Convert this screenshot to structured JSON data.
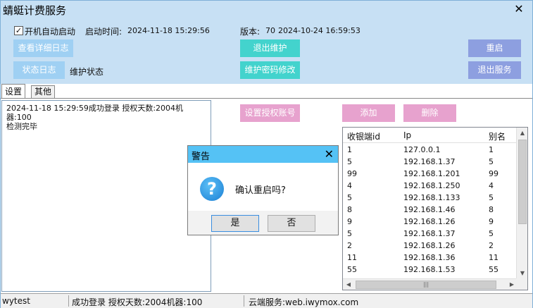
{
  "window": {
    "title": "蜻蜓计费服务",
    "close": "✕"
  },
  "top": {
    "autostart_label": "开机自动启动",
    "autostart_checked": "✓",
    "start_time_label": "启动时间:",
    "start_time_value": "2024-11-18 15:29:56",
    "version_label": "版本:",
    "version_value": "70",
    "version_date": "2024-10-24 16:59:53",
    "view_log_btn": "查看详细日志",
    "exit_maint_btn": "退出维护",
    "restart_btn": "重启",
    "status_log_btn": "状态日志",
    "maint_status_label": "维护状态",
    "maint_pwd_btn": "维护密码修改",
    "exit_service_btn": "退出服务"
  },
  "tabs": {
    "settings": "设置",
    "other": "其他"
  },
  "log": {
    "line1": "2024-11-18 15:29:59成功登录 授权天数:2004机器:100",
    "line2": "检测完毕"
  },
  "actions": {
    "set_auth_btn": "设置授权账号",
    "add_btn": "添加",
    "delete_btn": "删除"
  },
  "list": {
    "headers": {
      "id": "收银端id",
      "ip": "Ip",
      "alias": "别名"
    },
    "rows": [
      {
        "id": "1",
        "ip": "127.0.0.1",
        "alias": "1"
      },
      {
        "id": "5",
        "ip": "192.168.1.37",
        "alias": "5"
      },
      {
        "id": "99",
        "ip": "192.168.1.201",
        "alias": "99"
      },
      {
        "id": "4",
        "ip": "192.168.1.250",
        "alias": "4"
      },
      {
        "id": "5",
        "ip": "192.168.1.133",
        "alias": "5"
      },
      {
        "id": "8",
        "ip": "192.168.1.46",
        "alias": "8"
      },
      {
        "id": "9",
        "ip": "192.168.1.26",
        "alias": "9"
      },
      {
        "id": "5",
        "ip": "192.168.1.37",
        "alias": "5"
      },
      {
        "id": "2",
        "ip": "192.168.1.26",
        "alias": "2"
      },
      {
        "id": "11",
        "ip": "192.168.1.36",
        "alias": "11"
      },
      {
        "id": "55",
        "ip": "192.168.1.53",
        "alias": "55"
      }
    ]
  },
  "status": {
    "user": "wytest",
    "login_info": "成功登录 授权天数:2004机器:100",
    "cloud": "云端服务:web.iwymox.com"
  },
  "dialog": {
    "title": "警告",
    "message": "确认重启吗?",
    "icon": "?",
    "yes": "是",
    "no": "否",
    "close": "✕"
  }
}
